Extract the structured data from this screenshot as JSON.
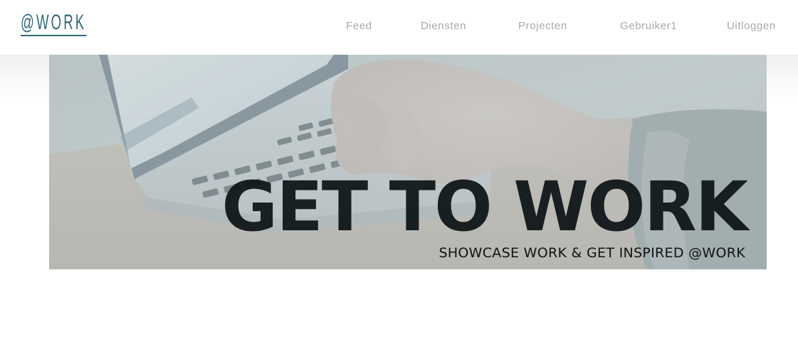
{
  "brand": {
    "logo_text": "@WORK",
    "color": "#2f6a77"
  },
  "nav": {
    "items": [
      {
        "label": "Feed"
      },
      {
        "label": "Diensten"
      },
      {
        "label": "Projecten"
      },
      {
        "label": "Gebruiker1"
      },
      {
        "label": "Uitloggen"
      }
    ]
  },
  "hero": {
    "title": "GET TO WORK",
    "subtitle": "SHOWCASE WORK & GET INSPIRED @WORK",
    "image": "laptop-typing-photo",
    "overlay_color": "#8fa9b0"
  }
}
